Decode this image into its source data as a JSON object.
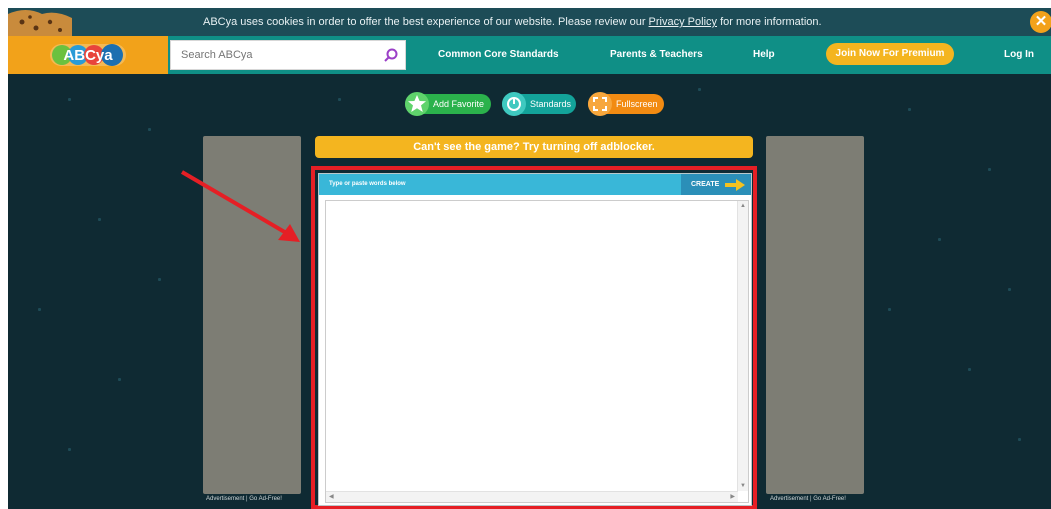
{
  "cookie_bar": {
    "text": "ABCya uses cookies in order to offer the best experience of our website. Please review our ",
    "link": "Privacy Policy",
    "text_after": " for more information.",
    "close_icon": "close-icon",
    "close_glyph": "✕"
  },
  "header": {
    "logo_text": "ABCya",
    "search_placeholder": "Search ABCya",
    "search_icon": "search-icon",
    "nav": [
      "Common Core Standards",
      "Parents & Teachers",
      "Help"
    ],
    "premium_button": "Join Now For Premium",
    "login": "Log In"
  },
  "actions": [
    {
      "label": "Add Favorite",
      "icon": "star-icon",
      "color": "#2bb24c"
    },
    {
      "label": "Standards",
      "icon": "standards-icon",
      "color": "#13a39a"
    },
    {
      "label": "Fullscreen",
      "icon": "fullscreen-icon",
      "color": "#f28b12"
    }
  ],
  "notice": "Can't see the game? Try turning off adblocker.",
  "ads": {
    "label": "Advertisement | Go Ad-Free!"
  },
  "game": {
    "bar_title": "Type or paste words below",
    "create_label": "CREATE",
    "textarea_value": ""
  },
  "colors": {
    "background": "#0f2a33",
    "cookie_bar": "#1d4c57",
    "header": "#0f8f86",
    "accent_orange": "#f2a21a",
    "highlight_red": "#e51f25"
  }
}
